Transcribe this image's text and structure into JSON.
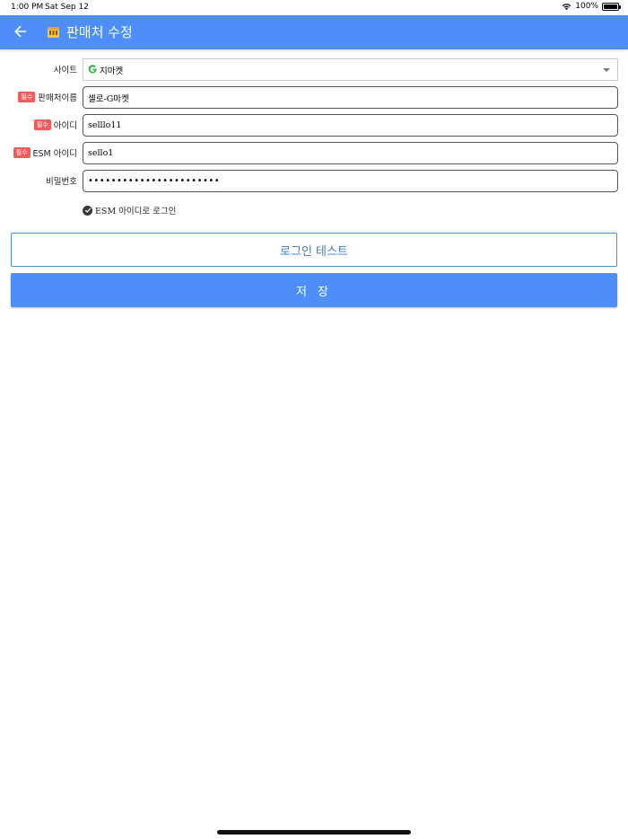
{
  "status_bar": {
    "time": "1:00 PM",
    "date": "Sat Sep 12",
    "battery": "100%"
  },
  "app_bar": {
    "title": "판매처 수정",
    "back_icon": "arrow-left-icon",
    "title_icon": "shop-icon"
  },
  "form": {
    "required_badge": "필수",
    "site": {
      "label": "사이트",
      "value": "지마켓",
      "icon": "g-logo-icon"
    },
    "seller_name": {
      "label": "판매처이름",
      "value": "셀로-G마켓",
      "required": true
    },
    "user_id": {
      "label": "아이디",
      "value": "selllo11",
      "required": true
    },
    "esm_id": {
      "label": "ESM 아이디",
      "value": "sello1",
      "required": true
    },
    "password": {
      "label": "비밀번호",
      "value": "•••••••••••••••••••••••"
    },
    "esm_login_checkbox": {
      "label": "ESM 아이디로 로그인",
      "checked": true
    }
  },
  "buttons": {
    "login_test": "로그인 테스트",
    "save": "저 장"
  },
  "colors": {
    "primary": "#4d8ef8",
    "required": "#f05b5b",
    "outline_button": "#4a90c8"
  }
}
